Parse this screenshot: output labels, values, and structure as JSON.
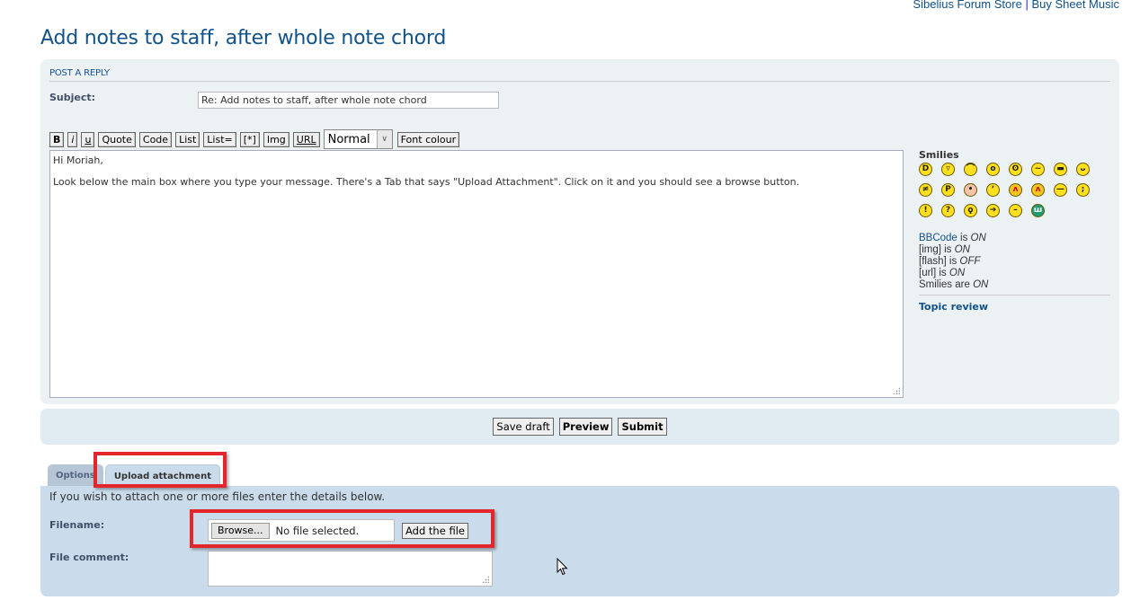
{
  "top_links": {
    "store": "Sibelius Forum Store",
    "separator": "|",
    "sheet_music": "Buy Sheet Music"
  },
  "page_title": "Add notes to staff, after whole note chord",
  "post_reply": {
    "heading": "POST A REPLY",
    "subject_label": "Subject:",
    "subject_value": "Re: Add notes to staff, after whole note chord"
  },
  "toolbar": {
    "buttons": [
      "B",
      "i",
      "u",
      "Quote",
      "Code",
      "List",
      "List=",
      "[*]",
      "Img",
      "URL"
    ],
    "font_size_selected": "Normal",
    "font_colour": "Font colour"
  },
  "message": "Hi Moriah,\n\nLook below the main box where you type your message. There's a Tab that says \"Upload Attachment\". Click on it and you should see a browse button.",
  "sidebar": {
    "smilies_heading": "Smilies",
    "smilies": [
      {
        "name": "very-happy",
        "glyph": "D"
      },
      {
        "name": "smile",
        "glyph": "▿"
      },
      {
        "name": "sad",
        "glyph": "⌒"
      },
      {
        "name": "surprised",
        "glyph": "o"
      },
      {
        "name": "shocked",
        "glyph": "ʘ"
      },
      {
        "name": "confused",
        "glyph": "~"
      },
      {
        "name": "cool",
        "glyph": "▬"
      },
      {
        "name": "laughing",
        "glyph": "ᴗ"
      },
      {
        "name": "mad",
        "glyph": "≠"
      },
      {
        "name": "razz",
        "glyph": "P"
      },
      {
        "name": "embarrassed",
        "glyph": "•"
      },
      {
        "name": "crying",
        "glyph": "ʼ"
      },
      {
        "name": "evil",
        "glyph": "ʌ"
      },
      {
        "name": "twisted-evil",
        "glyph": "ʌ"
      },
      {
        "name": "neutral",
        "glyph": "—"
      },
      {
        "name": "wink",
        "glyph": ";"
      },
      {
        "name": "exclaim",
        "glyph": "!"
      },
      {
        "name": "question",
        "glyph": "?"
      },
      {
        "name": "idea",
        "glyph": "ϙ"
      },
      {
        "name": "arrow",
        "glyph": "➔"
      },
      {
        "name": "neutral-2",
        "glyph": "–"
      },
      {
        "name": "mr-green",
        "glyph": "ш"
      }
    ],
    "rules": [
      {
        "label": "BBCode",
        "verb": " is ",
        "state": "ON",
        "link": true
      },
      {
        "label": "[img]",
        "verb": " is ",
        "state": "ON",
        "link": false
      },
      {
        "label": "[flash]",
        "verb": " is ",
        "state": "OFF",
        "link": false
      },
      {
        "label": "[url]",
        "verb": " is ",
        "state": "ON",
        "link": false
      },
      {
        "label": "Smilies",
        "verb": " are ",
        "state": "ON",
        "link": false
      }
    ],
    "topic_review": "Topic review"
  },
  "submit_bar": {
    "save_draft": "Save draft",
    "preview": "Preview",
    "submit": "Submit"
  },
  "tabs": [
    {
      "label": "Options",
      "active": false
    },
    {
      "label": "Upload attachment",
      "active": true
    }
  ],
  "attachment": {
    "intro": "If you wish to attach one or more files enter the details below.",
    "filename_label": "Filename:",
    "browse": "Browse...",
    "no_file": "No file selected.",
    "add_file": "Add the file",
    "file_comment_label": "File comment:",
    "file_comment_value": ""
  },
  "colors": {
    "link": "#105289",
    "highlight": "#e3262b",
    "panel_post": "#ECF1F3",
    "panel_submit": "#E1EBF2",
    "panel_attach": "#CADCEB"
  }
}
